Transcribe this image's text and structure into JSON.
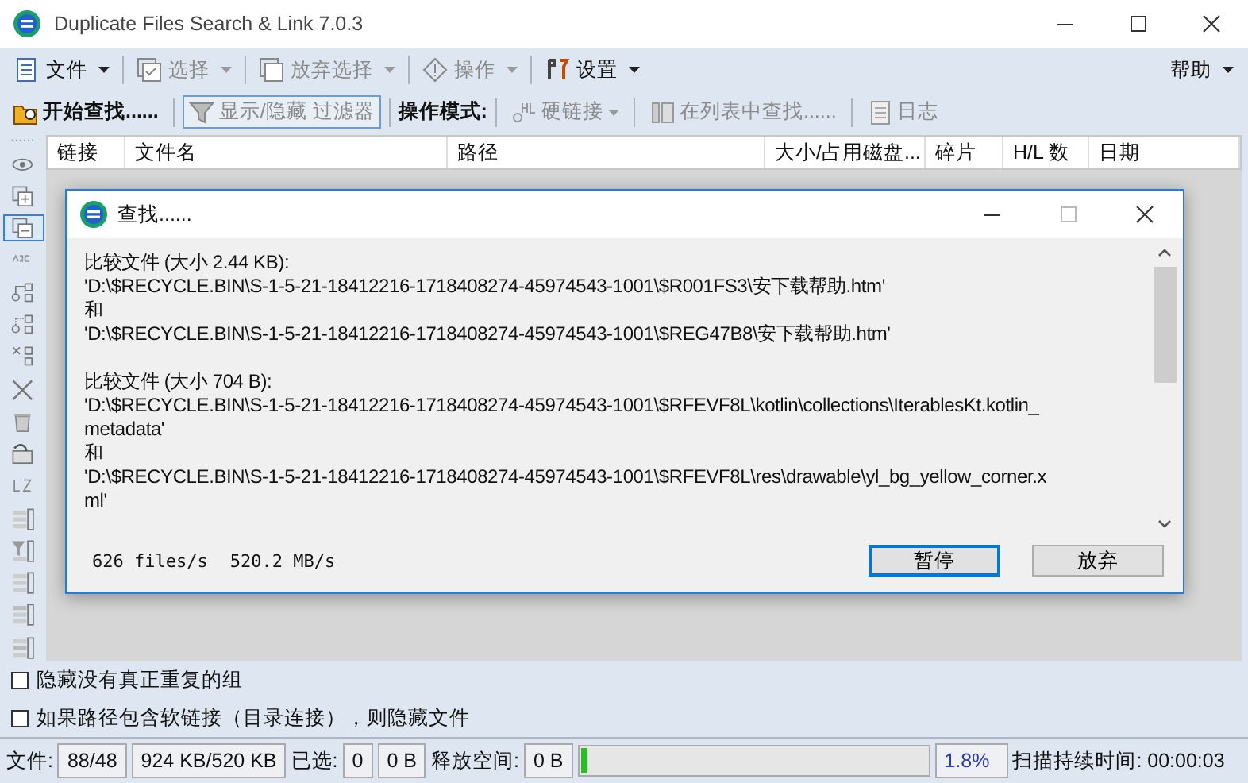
{
  "window": {
    "title": "Duplicate Files Search & Link 7.0.3"
  },
  "menu": [
    {
      "label": "文件",
      "disabled": false
    },
    {
      "label": "选择",
      "disabled": true
    },
    {
      "label": "放弃选择",
      "disabled": true
    },
    {
      "label": "操作",
      "disabled": true
    },
    {
      "label": "设置",
      "disabled": false
    }
  ],
  "help_menu": {
    "label": "帮助"
  },
  "toolbar": {
    "start": "开始查找......",
    "filter": {
      "label": "显示/隐藏 过滤器",
      "pressed": true
    },
    "mode_label": "操作模式:",
    "mode": {
      "label": "硬链接",
      "disabled": true
    },
    "find_in_list": {
      "label": "在列表中查找......",
      "disabled": true
    },
    "log": {
      "label": "日志",
      "disabled": true
    }
  },
  "table": {
    "columns": [
      "链接",
      "文件名",
      "路径",
      "大小/占用磁盘...",
      "碎片",
      "H/L 数",
      "日期"
    ]
  },
  "left_toolbar": [
    {
      "selected": false
    },
    {
      "selected": false
    },
    {
      "selected": true
    },
    {
      "selected": false
    },
    {
      "selected": false
    },
    {
      "selected": false
    },
    {
      "selected": false
    },
    {
      "selected": false
    },
    {
      "selected": false
    },
    {
      "selected": false
    },
    {
      "selected": false
    },
    {
      "selected": false
    },
    {
      "selected": false
    },
    {
      "selected": false
    },
    {
      "selected": false
    },
    {
      "selected": false
    }
  ],
  "dialog": {
    "title": "查找......",
    "groups": [
      [
        "比较文件 (大小 2.44 KB):",
        "'D:\\$RECYCLE.BIN\\S-1-5-21-18412216-1718408274-45974543-1001\\$R001FS3\\安下载帮助.htm'",
        "和",
        "'D:\\$RECYCLE.BIN\\S-1-5-21-18412216-1718408274-45974543-1001\\$REG47B8\\安下载帮助.htm'"
      ],
      [
        "比较文件 (大小 704 B):",
        "'D:\\$RECYCLE.BIN\\S-1-5-21-18412216-1718408274-45974543-1001\\$RFEVF8L\\kotlin\\collections\\IterablesKt.kotlin_",
        "metadata'",
        "和",
        "'D:\\$RECYCLE.BIN\\S-1-5-21-18412216-1718408274-45974543-1001\\$RFEVF8L\\res\\drawable\\yl_bg_yellow_corner.x",
        "ml'"
      ]
    ],
    "rate": "626 files/s",
    "throughput": "520.2 MB/s",
    "buttons": [
      {
        "label": "暂停",
        "default": true
      },
      {
        "label": "放弃",
        "default": false
      }
    ]
  },
  "options": [
    {
      "label": "隐藏没有真正重复的组",
      "checked": false
    },
    {
      "label": "如果路径包含软链接（目录连接），则隐藏文件",
      "checked": false
    }
  ],
  "status_bar": {
    "files_label": "文件:",
    "files_count": "88/48",
    "files_size": "924 KB/520 KB",
    "selected_label": "已选:",
    "selected_count": "0",
    "selected_size": "0 B",
    "freed_label": "释放空间:",
    "freed": "0 B",
    "progress": {
      "level": 0.018
    },
    "percent": "1.8%",
    "duration": "扫描持续时间: 00:00:03"
  }
}
